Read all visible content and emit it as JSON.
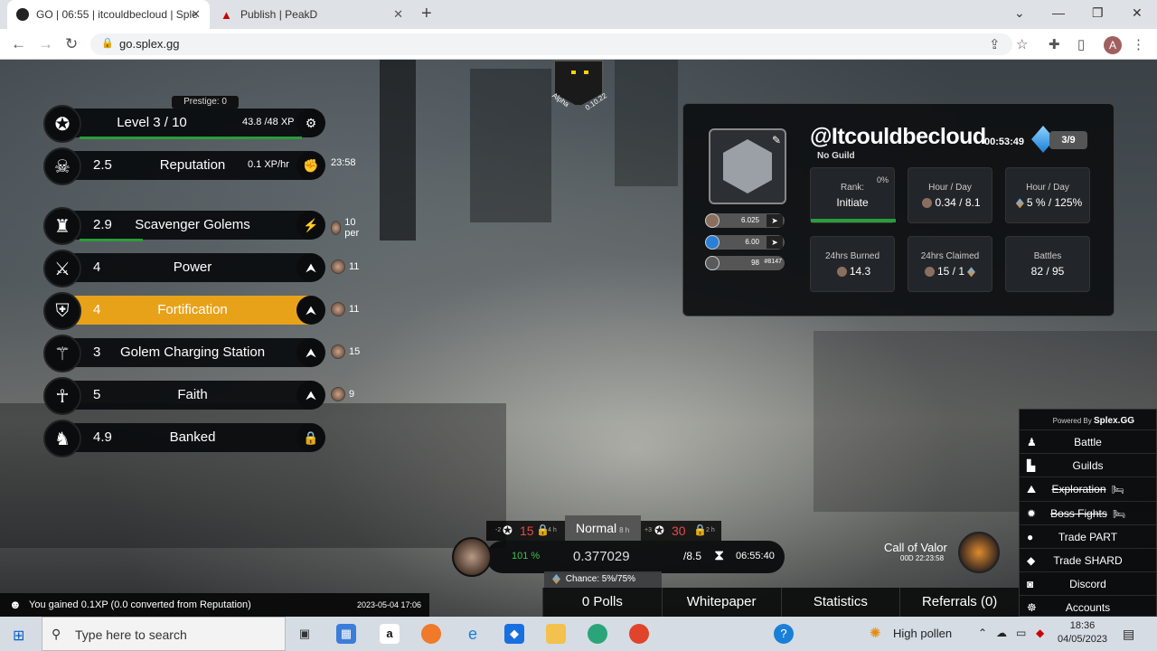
{
  "browser": {
    "tabs": [
      {
        "title": "GO | 06:55 | itcouldbecloud | Sple",
        "active": true
      },
      {
        "title": "Publish | PeakD",
        "active": false
      }
    ],
    "url": "go.splex.gg",
    "profile_initial": "A"
  },
  "game": {
    "prestige": "Prestige: 0",
    "level": {
      "label": "Level 3 / 10",
      "xp": "43.8 /48 XP",
      "progress": 0.9125
    },
    "reputation": {
      "value": "2.5",
      "label": "Reputation",
      "rate": "0.1 XP/hr",
      "timer": "23:58"
    },
    "upgrades": [
      {
        "value": "2.9",
        "name": "Scavenger Golems",
        "cost": "10 per",
        "highlight": false,
        "icon": "golem-icon"
      },
      {
        "value": "4",
        "name": "Power",
        "cost": "11",
        "highlight": false,
        "icon": "power-icon"
      },
      {
        "value": "4",
        "name": "Fortification",
        "cost": "11",
        "highlight": true,
        "icon": "fortification-icon"
      },
      {
        "value": "3",
        "name": "Golem Charging Station",
        "cost": "15",
        "highlight": false,
        "icon": "charging-station-icon"
      },
      {
        "value": "5",
        "name": "Faith",
        "cost": "9",
        "highlight": false,
        "icon": "faith-icon"
      },
      {
        "value": "4.9",
        "name": "Banked",
        "cost": "",
        "highlight": false,
        "icon": "piggy-bank-icon"
      }
    ],
    "alpha": {
      "label": "Alpha",
      "version": "0.10.22"
    }
  },
  "profile": {
    "username": "@Itcouldbecloud",
    "guild": "No Guild",
    "timer": "00:53:49",
    "gem_count": "3/9",
    "balances": [
      {
        "value": "6.025"
      },
      {
        "value": "6.00"
      },
      {
        "value": "98",
        "rank": "#8147"
      }
    ],
    "stats": {
      "rank": {
        "label": "Rank:",
        "value": "Initiate",
        "pct": "0%"
      },
      "hour_day_1": {
        "label": "Hour / Day",
        "value": "0.34 / 8.1"
      },
      "hour_day_2": {
        "label": "Hour / Day",
        "value": "5 % / 125%"
      },
      "burned": {
        "label": "24hrs Burned",
        "value": "14.3"
      },
      "claimed": {
        "label": "24hrs Claimed",
        "value": "15 / 1"
      },
      "battles": {
        "label": "Battles",
        "value": "82 / 95"
      }
    }
  },
  "menu": {
    "powered_prefix": "Powered By",
    "powered_brand": "Splex.GG",
    "items": [
      {
        "label": "Battle",
        "icon": "battle-icon",
        "strike": false
      },
      {
        "label": "Guilds",
        "icon": "guilds-icon",
        "strike": false
      },
      {
        "label": "Exploration",
        "icon": "exploration-icon",
        "strike": true
      },
      {
        "label": "Boss Fights",
        "icon": "boss-icon",
        "strike": true
      },
      {
        "label": "Trade PART",
        "icon": "part-coin-icon",
        "strike": false
      },
      {
        "label": "Trade SHARD",
        "icon": "shard-icon",
        "strike": false
      },
      {
        "label": "Discord",
        "icon": "discord-icon",
        "strike": false
      },
      {
        "label": "Accounts",
        "icon": "accounts-icon",
        "strike": false
      }
    ]
  },
  "battle_bar": {
    "mode": "Normal",
    "mode_time": "8 h",
    "left_value": "15",
    "left_small": "-2",
    "left_time": "4 h",
    "right_value": "30",
    "right_small": "+3",
    "right_time": "2 h",
    "win_pct": "101 %",
    "amount": "0.377029",
    "divisor": "/8.5",
    "countdown": "06:55:40",
    "chance": "Chance: 5%/75%",
    "call_of_valor": "Call of Valor",
    "cov_timer": "00D 22:23:58"
  },
  "bottom_nav": [
    "0 Polls",
    "Whitepaper",
    "Statistics",
    "Referrals (0)"
  ],
  "toast": {
    "message": "You gained 0.1XP (0.0 converted from Reputation)",
    "time": "2023-05-04 17:06"
  },
  "taskbar": {
    "search_placeholder": "Type here to search",
    "weather": "High pollen",
    "time": "18:36",
    "date": "04/05/2023"
  }
}
